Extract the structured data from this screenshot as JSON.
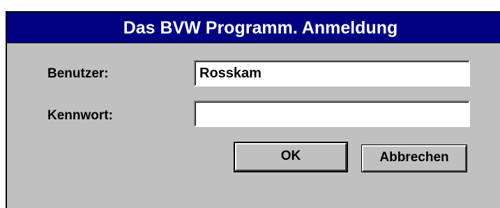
{
  "window": {
    "title": "Das BVW Programm. Anmeldung"
  },
  "form": {
    "user_label": "Benutzer:",
    "user_value": "Rosskam",
    "password_label": "Kennwort:",
    "password_value": ""
  },
  "buttons": {
    "ok_label": "OK",
    "cancel_label": "Abbrechen"
  },
  "colors": {
    "titlebar": "#000080",
    "dialog_face": "#c0c0c0"
  }
}
